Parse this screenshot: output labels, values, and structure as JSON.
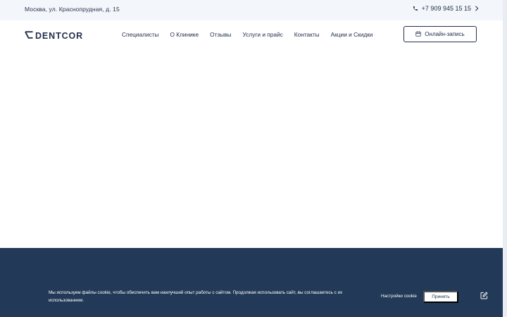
{
  "topbar": {
    "address": "Москва, ул. Краснопрудная, д. 15",
    "phone": "+7 909 945 15 15"
  },
  "header": {
    "logo_text": "DENTCOR",
    "nav": [
      {
        "label": "Специалисты"
      },
      {
        "label": "О Клинике"
      },
      {
        "label": "Отзывы"
      },
      {
        "label": "Услуги и прайс"
      },
      {
        "label": "Контакты"
      },
      {
        "label": "Акции и Скидки"
      }
    ],
    "booking_label": "Онлайн-запись"
  },
  "cookie": {
    "text": "Мы используем файлы cookie, чтобы обеспечить вам наилучший опыт работы с сайтом. Продолжая использовать сайт, вы соглашаетесь с их использованием.",
    "settings_label": "Настройки cookie",
    "accept_label": "Принять"
  },
  "icons": {
    "phone": "phone-icon",
    "chevron": "chevron-right-icon",
    "calendar": "calendar-icon",
    "edit": "edit-icon"
  },
  "colors": {
    "brand_dark": "#22304d",
    "footer_bg": "#223a57",
    "topbar_bg": "#f3f6fa"
  }
}
